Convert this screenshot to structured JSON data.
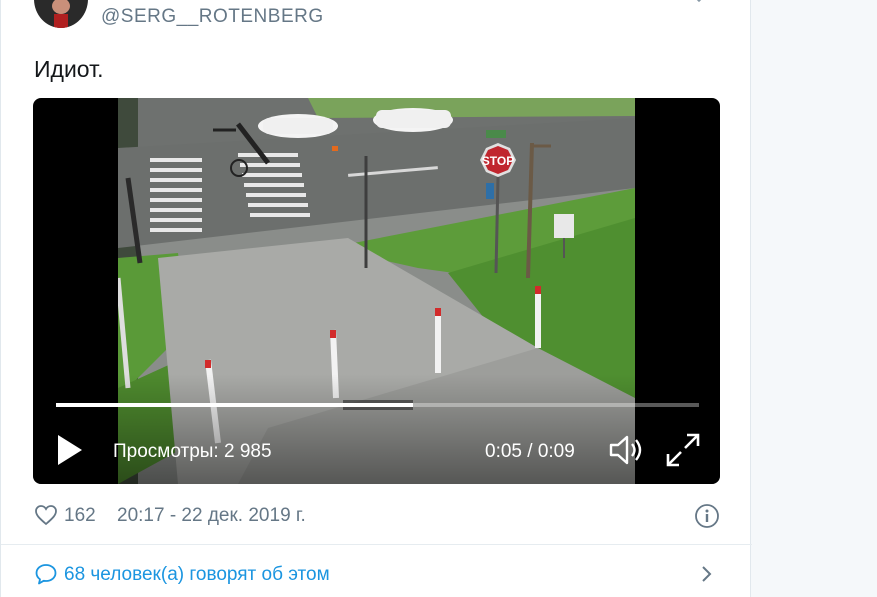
{
  "tweet": {
    "handle": "@SERG__ROTENBERG",
    "text": "Идиот."
  },
  "video": {
    "views_label": "Просмотры: 2 985",
    "time": "0:05 / 0:09",
    "progress": 0.555,
    "scene_sign_text": "STOP"
  },
  "meta": {
    "likes": "162",
    "timestamp": "20:17 - 22 дек. 2019 г."
  },
  "conversation": {
    "label": "68 человек(а) говорят об этом"
  },
  "colors": {
    "link": "#1b95e0",
    "muted": "#657786",
    "text": "#14171a"
  },
  "icons": [
    "heart-icon",
    "info-icon",
    "speech-bubble-icon",
    "chevron-right-icon",
    "play-icon",
    "volume-icon",
    "fullscreen-icon"
  ]
}
